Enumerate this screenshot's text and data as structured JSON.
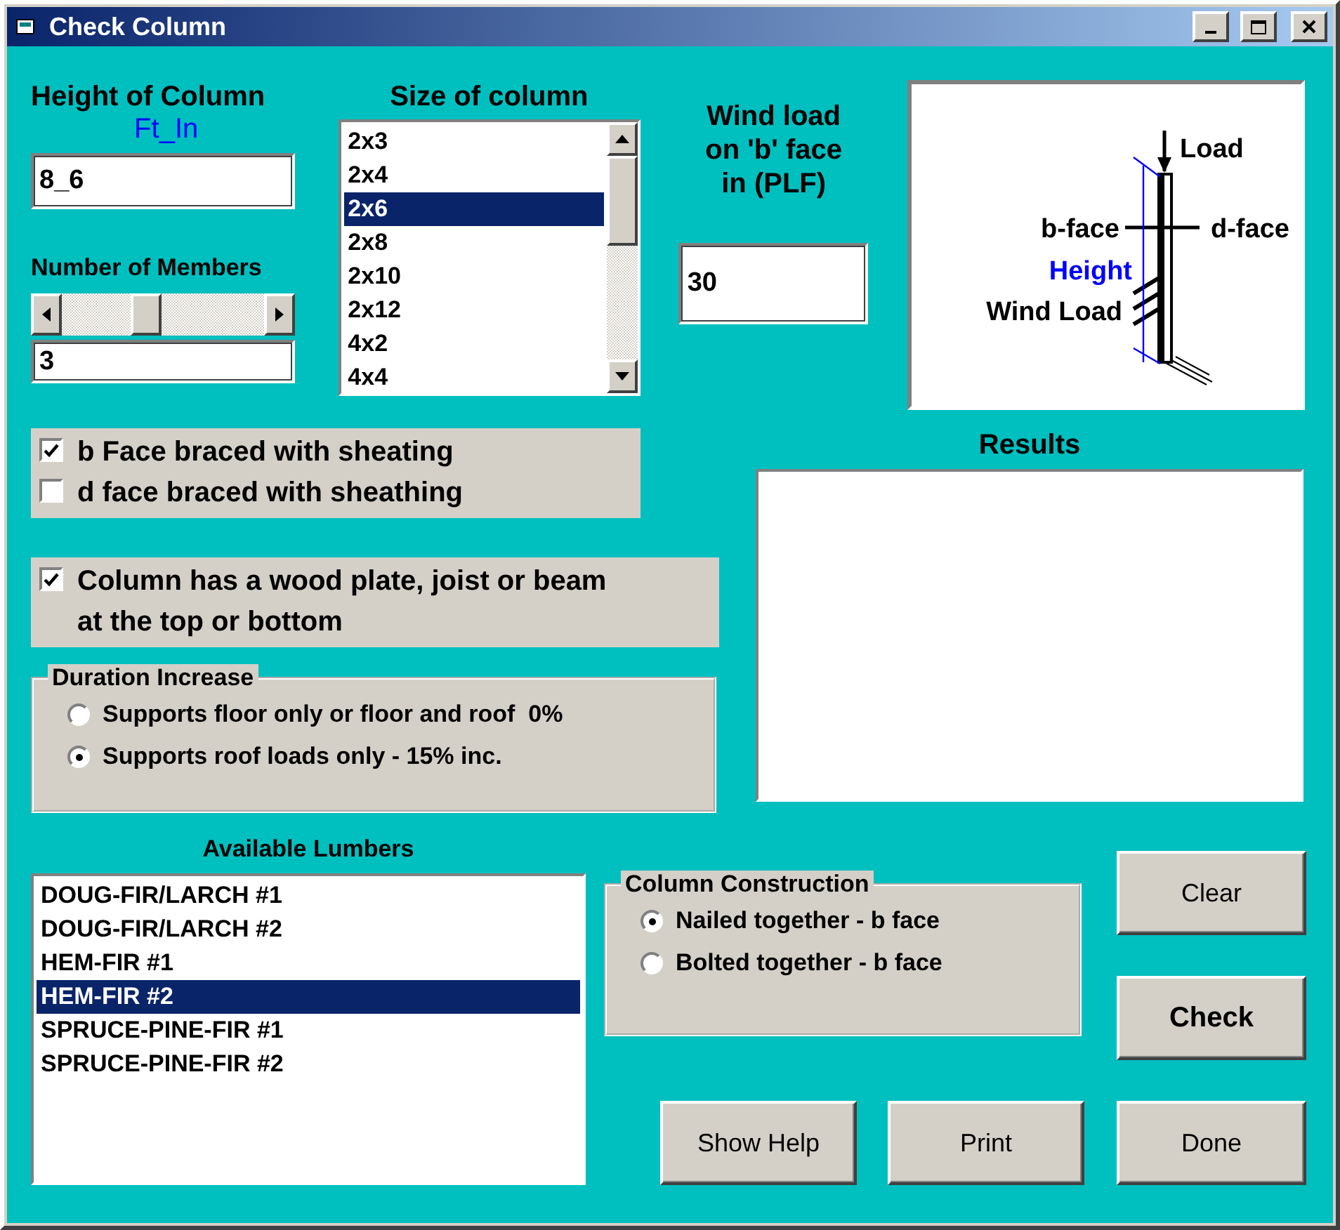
{
  "window": {
    "title": "Check Column"
  },
  "height_of_column": {
    "label": "Height of Column",
    "unit": "Ft_In",
    "value": "8_6"
  },
  "number_of_members": {
    "label": "Number of Members",
    "level": 0.4,
    "value": "3"
  },
  "size_of_column": {
    "label": "Size of column",
    "items": [
      {
        "label": "2x3",
        "selected": false
      },
      {
        "label": "2x4",
        "selected": false
      },
      {
        "label": "2x6",
        "selected": true
      },
      {
        "label": "2x8",
        "selected": false
      },
      {
        "label": "2x10",
        "selected": false
      },
      {
        "label": "2x12",
        "selected": false
      },
      {
        "label": "4x2",
        "selected": false
      },
      {
        "label": "4x4",
        "selected": false
      }
    ]
  },
  "wind_load": {
    "label_lines": [
      "Wind load",
      "on 'b' face",
      "in (PLF)"
    ],
    "value": "30"
  },
  "diagram": {
    "load": "Load",
    "b_face": "b-face",
    "d_face": "d-face",
    "height": "Height",
    "wind_load": "Wind Load"
  },
  "bracing": [
    {
      "label": "b Face braced with sheating",
      "checked": true
    },
    {
      "label": "d face braced with sheathing",
      "checked": false
    }
  ],
  "end_support": {
    "label": "Column has a wood plate, joist or beam at the top or bottom",
    "checked": true
  },
  "duration_increase": {
    "title": "Duration Increase",
    "options": [
      {
        "label": "Supports floor only or floor and roof  0%",
        "selected": false
      },
      {
        "label": "Supports roof loads only - 15% inc.",
        "selected": true
      }
    ]
  },
  "results": {
    "label": "Results"
  },
  "available_lumbers": {
    "label": "Available Lumbers",
    "items": [
      {
        "label": "DOUG-FIR/LARCH #1",
        "selected": false
      },
      {
        "label": "DOUG-FIR/LARCH #2",
        "selected": false
      },
      {
        "label": "HEM-FIR #1",
        "selected": false
      },
      {
        "label": "HEM-FIR #2",
        "selected": true
      },
      {
        "label": "SPRUCE-PINE-FIR #1",
        "selected": false
      },
      {
        "label": "SPRUCE-PINE-FIR #2",
        "selected": false
      }
    ]
  },
  "column_construction": {
    "title": "Column Construction",
    "options": [
      {
        "label": "Nailed together - b face",
        "selected": true
      },
      {
        "label": "Bolted together - b face",
        "selected": false
      }
    ]
  },
  "buttons": [
    {
      "label": "Clear",
      "kind": "plain"
    },
    {
      "label": "Check",
      "kind": "default"
    },
    {
      "label": "Show Help",
      "kind": "plain"
    },
    {
      "label": "Print",
      "kind": "plain"
    },
    {
      "label": "Done",
      "kind": "plain"
    }
  ]
}
